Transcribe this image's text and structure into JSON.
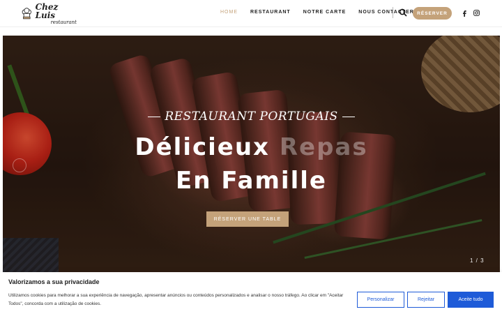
{
  "header": {
    "logo_name": "Chez Luis",
    "logo_sub": "restaurant",
    "nav": [
      "HOME",
      "RESTAURANT",
      "NOTRE CARTE",
      "NOUS CONTACTER"
    ],
    "reserve_label": "RÉSERVER",
    "social": [
      "facebook-icon",
      "instagram-icon"
    ],
    "accent_color": "#c4a27a"
  },
  "hero": {
    "subtitle": "RESTAURANT PORTUGAIS",
    "title_line1_a": "Délicieux ",
    "title_line1_b": "Repas",
    "title_line2": "En Famille",
    "cta_label": "RÉSERVER UNE TABLE",
    "slide_counter": "1 / 3"
  },
  "cookie_banner": {
    "title": "Valorizamos a sua privacidade",
    "text": "Utilizamos cookies para melhorar a sua experiência de navegação, apresentar anúncios ou conteúdos personalizados e analisar o nosso tráfego. Ao clicar em \"Aceitar Todos\", concorda com a utilização de cookies.",
    "buttons": [
      "Personalizar",
      "Rejeitar",
      "Aceite tudo"
    ],
    "button_color": "#1e5bd8"
  }
}
